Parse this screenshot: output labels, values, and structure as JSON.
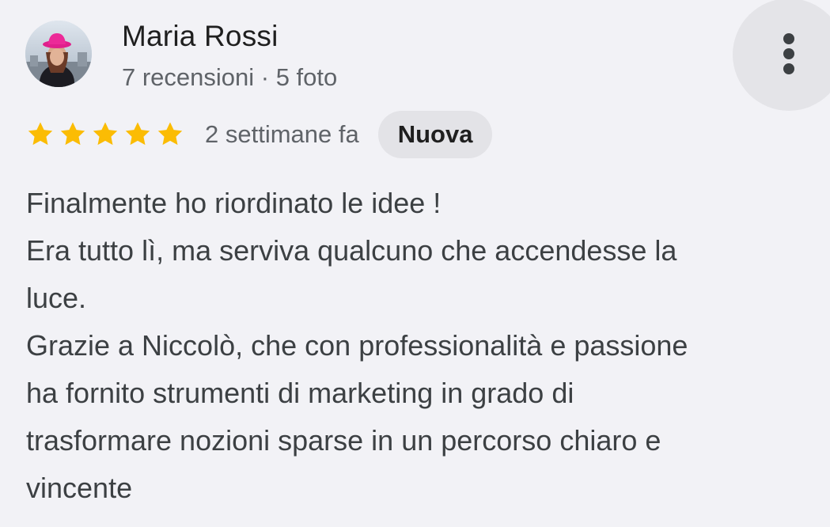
{
  "reviewer": {
    "name": "Maria Rossi",
    "meta": "7 recensioni · 5 foto"
  },
  "review": {
    "rating": 5,
    "rating_max": 5,
    "time_ago": "2 settimane fa",
    "badge": "Nuova",
    "lines": [
      "Finalmente ho riordinato le idee !",
      "Era tutto lì, ma serviva qualcuno che accendesse la",
      "luce.",
      "Grazie a Niccolò, che con professionalità e passione",
      "ha fornito strumenti di marketing in grado di",
      "trasformare nozioni sparse in un percorso chiaro e",
      "vincente"
    ]
  },
  "icons": {
    "more": "more-vert-icon",
    "star": "star-icon"
  },
  "colors": {
    "background": "#f2f2f6",
    "star": "#fbbc04",
    "badge_bg": "#e3e3e7",
    "text_primary": "#1f1f1f",
    "text_secondary": "#5f6368"
  }
}
